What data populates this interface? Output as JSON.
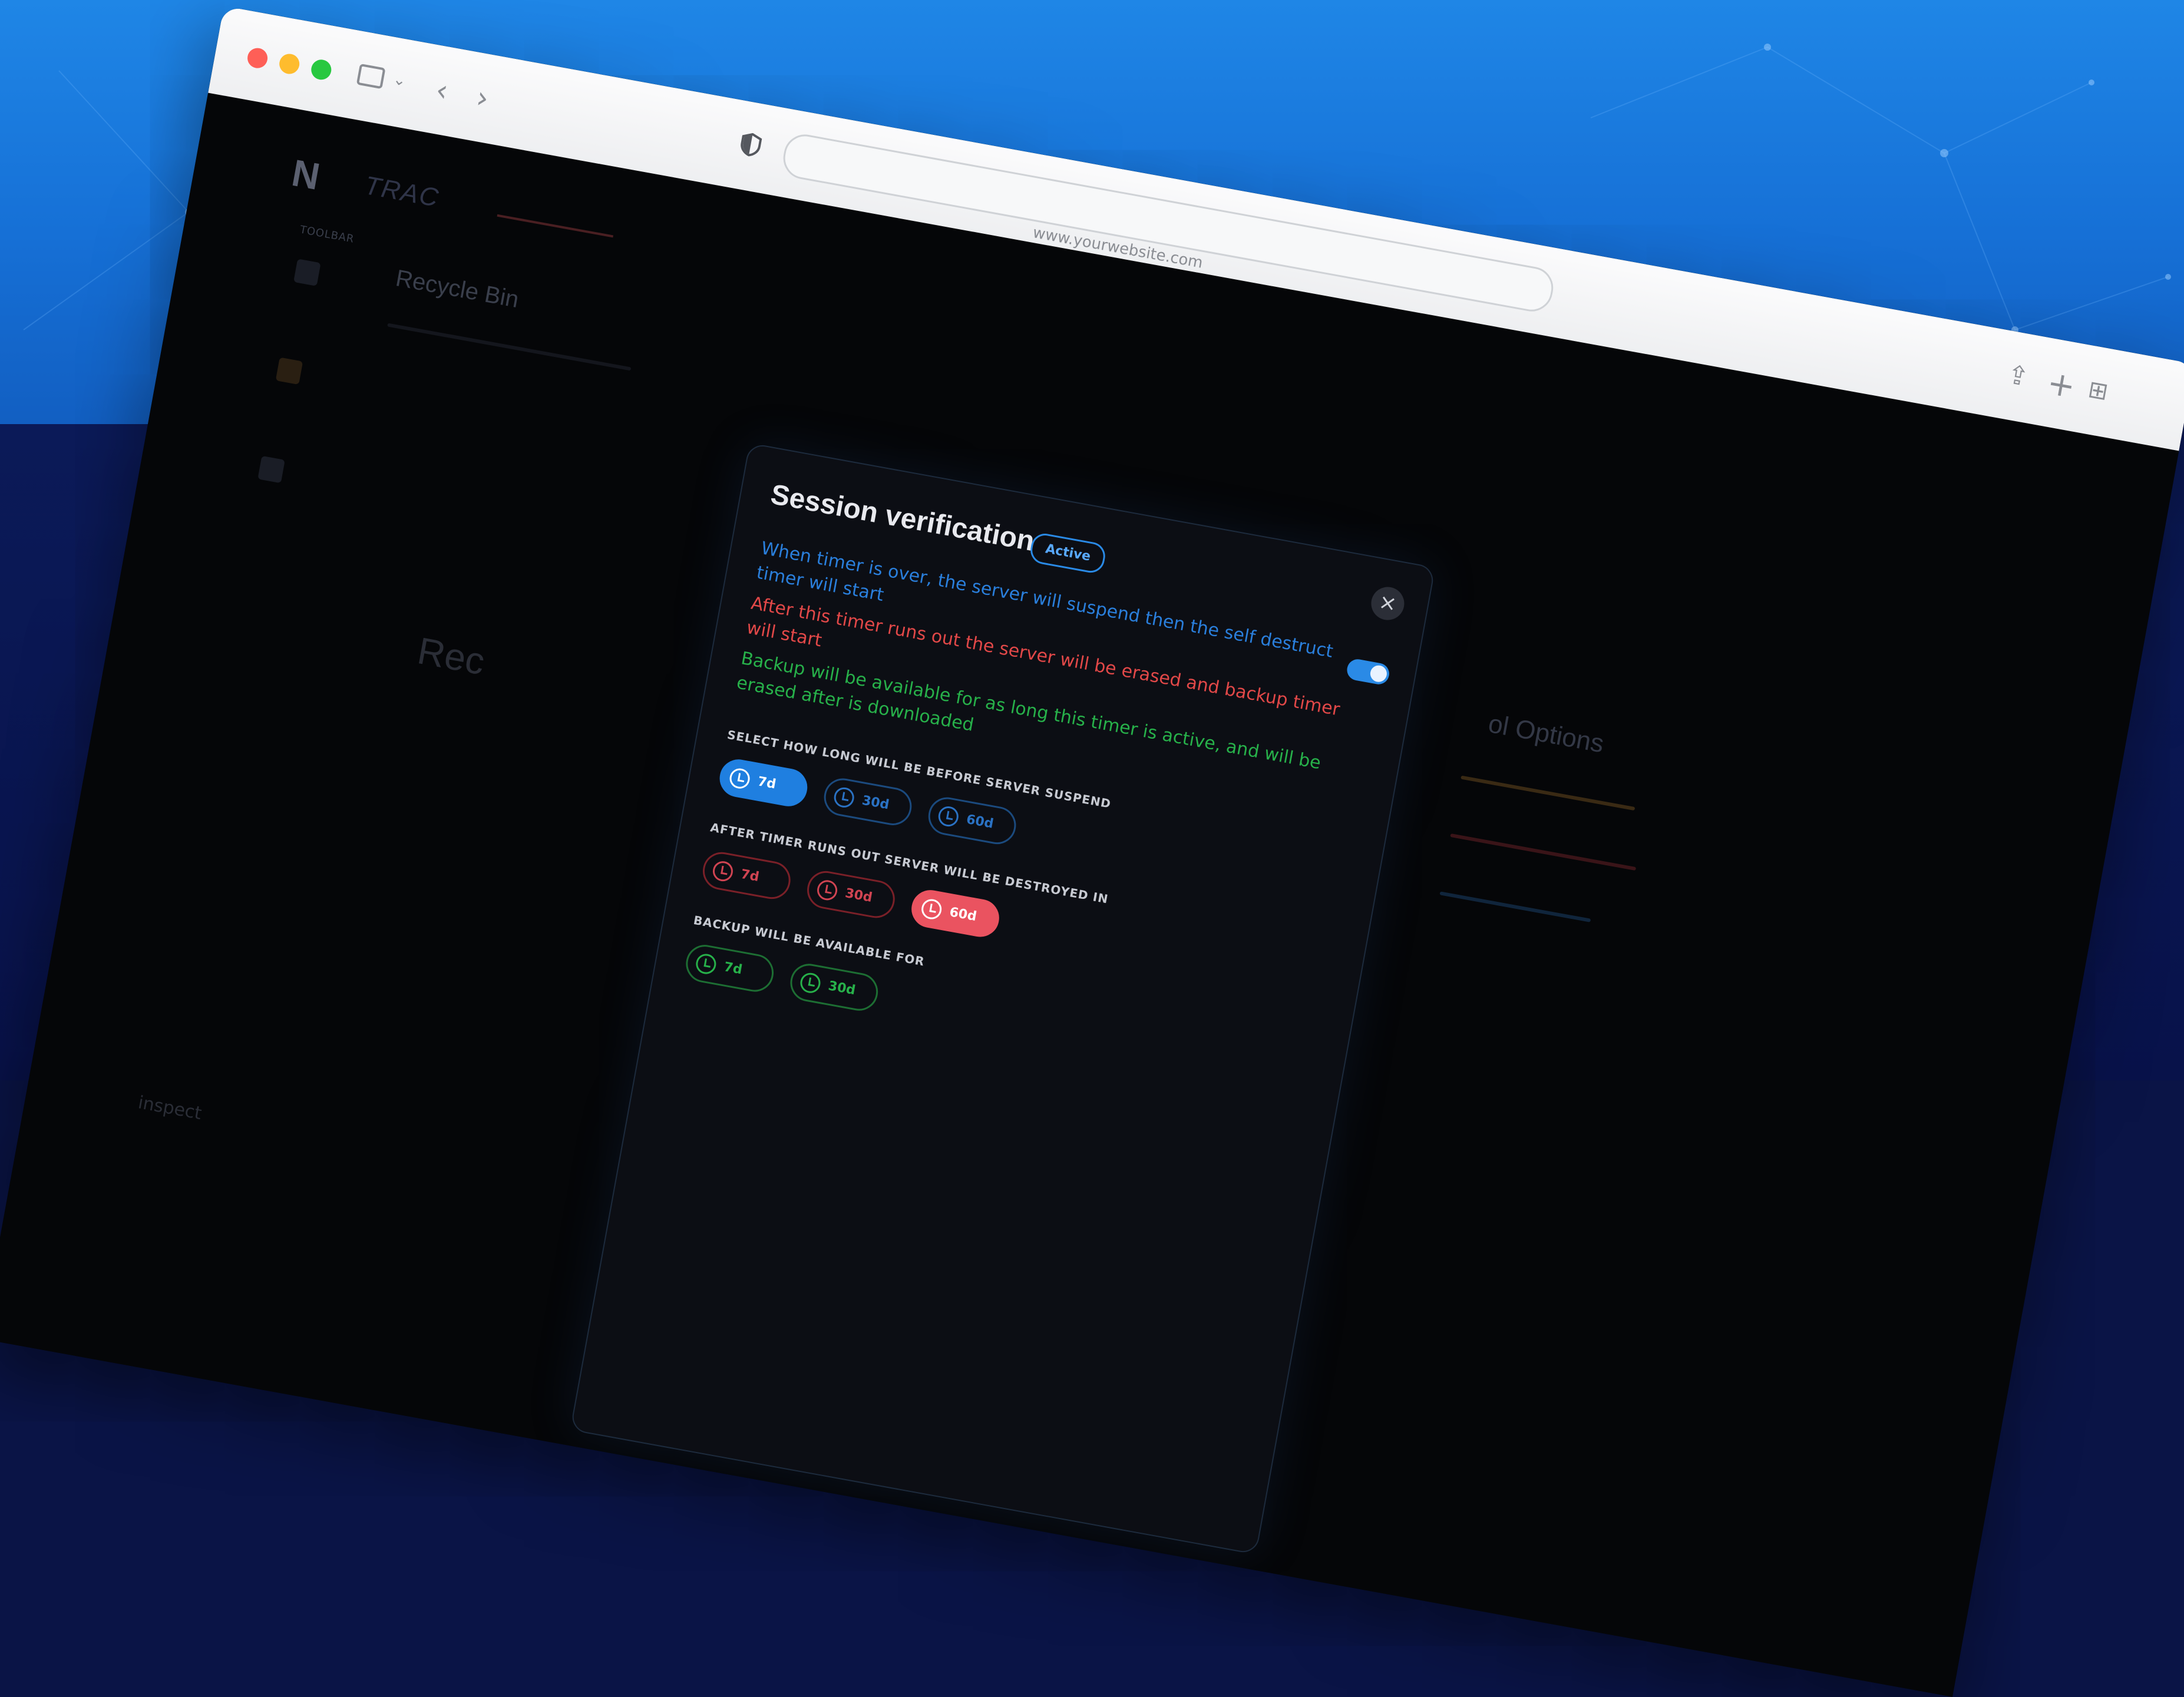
{
  "browser": {
    "url": "www.yourwebsite.com"
  },
  "app": {
    "logo": "N",
    "brand": "TRAC",
    "nav_label": "TOOLBAR",
    "page_title": "Recycle Bin",
    "bg_heading": "Rec",
    "bg_options": "ol Options",
    "bg_bottom": "inspect"
  },
  "modal": {
    "title": "Session verification",
    "status": "Active",
    "close": "×",
    "toggle_on": true,
    "desc_blue": "When timer is over, the server will suspend then the self destruct timer will start",
    "desc_red": "After this timer runs out the server will be erased and backup timer will start",
    "desc_green": "Backup will be available for as long this timer is active, and will be erased after is downloaded",
    "suspend": {
      "label": "SELECT HOW LONG WILL BE BEFORE SERVER SUSPEND",
      "options": [
        {
          "label": "7d",
          "selected": true
        },
        {
          "label": "30d",
          "selected": false
        },
        {
          "label": "60d",
          "selected": false
        }
      ]
    },
    "destroy": {
      "label": "AFTER TIMER RUNS OUT SERVER WILL BE DESTROYED IN",
      "options": [
        {
          "label": "7d",
          "selected": false
        },
        {
          "label": "30d",
          "selected": false
        },
        {
          "label": "60d",
          "selected": true
        }
      ]
    },
    "backup": {
      "label": "BACKUP WILL BE AVAILABLE FOR",
      "options": [
        {
          "label": "7d",
          "selected": false
        },
        {
          "label": "30d",
          "selected": false
        }
      ]
    }
  },
  "colors": {
    "accent_blue": "#1f7fe0",
    "danger_red": "#ea5360",
    "success_green": "#27b14a"
  }
}
